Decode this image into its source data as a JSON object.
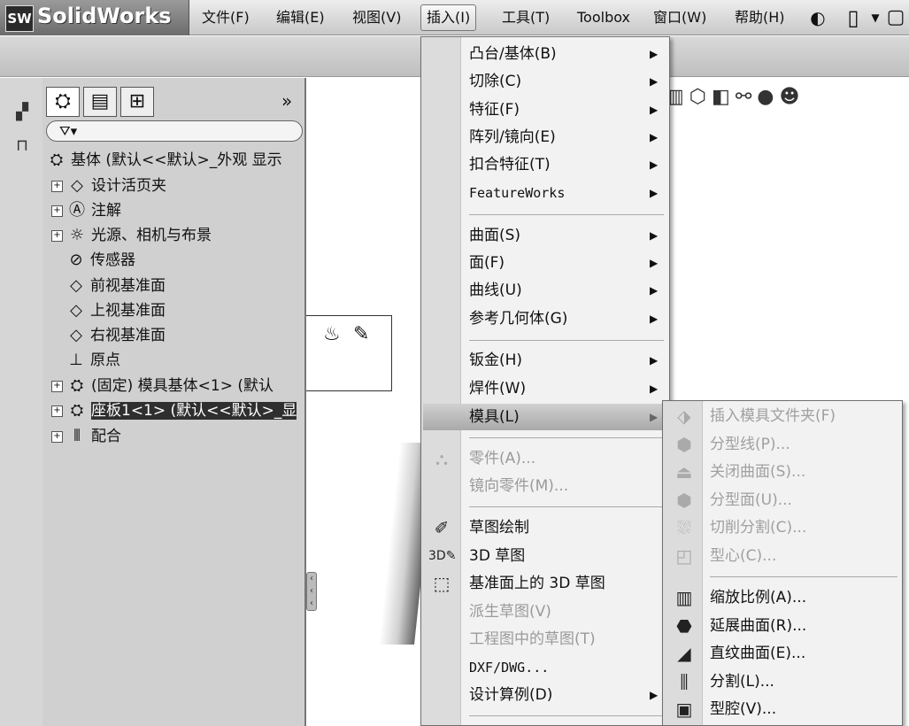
{
  "app": {
    "logo_badge": "SW",
    "logo_text": "SolidWorks"
  },
  "menubar": {
    "items": [
      {
        "label": "文件(F)"
      },
      {
        "label": "编辑(E)"
      },
      {
        "label": "视图(V)"
      },
      {
        "label": "插入(I)"
      },
      {
        "label": "工具(T)"
      },
      {
        "label": "Toolbox"
      },
      {
        "label": "窗口(W)"
      },
      {
        "label": "帮助(H)"
      }
    ],
    "active_index": 3
  },
  "tree": {
    "collapse_label": "»",
    "filter_label": "▾",
    "root": "基体  (默认<<默认>_外观 显示",
    "nodes": [
      {
        "label": "设计活页夹",
        "expand": "+",
        "icon": "binder-icon"
      },
      {
        "label": "注解",
        "expand": "+",
        "icon": "annotation-icon"
      },
      {
        "label": "光源、相机与布景",
        "expand": "+",
        "icon": "lights-icon"
      },
      {
        "label": "传感器",
        "expand": "",
        "icon": "sensor-icon"
      },
      {
        "label": "前视基准面",
        "expand": "",
        "icon": "plane-icon"
      },
      {
        "label": "上视基准面",
        "expand": "",
        "icon": "plane-icon"
      },
      {
        "label": "右视基准面",
        "expand": "",
        "icon": "plane-icon"
      },
      {
        "label": "原点",
        "expand": "",
        "icon": "origin-icon"
      },
      {
        "label": "(固定) 模具基体<1> (默认",
        "expand": "+",
        "icon": "part-icon"
      },
      {
        "label": "座板1<1> (默认<<默认>_显",
        "expand": "+",
        "icon": "part-icon",
        "selected": true
      },
      {
        "label": "配合",
        "expand": "+",
        "icon": "mates-icon"
      }
    ]
  },
  "insert_menu": {
    "items": [
      {
        "label": "凸台/基体(B)",
        "submenu": true
      },
      {
        "label": "切除(C)",
        "submenu": true
      },
      {
        "label": "特征(F)",
        "submenu": true
      },
      {
        "label": "阵列/镜向(E)",
        "submenu": true
      },
      {
        "label": "扣合特征(T)",
        "submenu": true
      },
      {
        "label": "FeatureWorks",
        "submenu": true
      },
      {
        "label": "曲面(S)",
        "submenu": true
      },
      {
        "label": "面(F)",
        "submenu": true
      },
      {
        "label": "曲线(U)",
        "submenu": true
      },
      {
        "label": "参考几何体(G)",
        "submenu": true
      },
      {
        "label": "钣金(H)",
        "submenu": true
      },
      {
        "label": "焊件(W)",
        "submenu": true
      },
      {
        "label": "模具(L)",
        "submenu": true,
        "highlighted": true
      },
      {
        "label": "零件(A)...",
        "disabled": true
      },
      {
        "label": "镜向零件(M)...",
        "disabled": true
      },
      {
        "label": "草图绘制"
      },
      {
        "label": "3D 草图"
      },
      {
        "label": "基准面上的 3D 草图"
      },
      {
        "label": "派生草图(V)",
        "disabled": true
      },
      {
        "label": "工程图中的草图(T)",
        "disabled": true
      },
      {
        "label": "DXF/DWG..."
      },
      {
        "label": "设计算例(D)",
        "submenu": true
      }
    ],
    "arrow": "▶"
  },
  "mold_submenu": {
    "items": [
      {
        "label": "插入模具文件夹(F)",
        "disabled": true
      },
      {
        "label": "分型线(P)...",
        "disabled": true
      },
      {
        "label": "关闭曲面(S)...",
        "disabled": true
      },
      {
        "label": "分型面(U)...",
        "disabled": true
      },
      {
        "label": "切削分割(C)...",
        "disabled": true
      },
      {
        "label": "型心(C)...",
        "disabled": true
      },
      {
        "label": "缩放比例(A)..."
      },
      {
        "label": "延展曲面(R)..."
      },
      {
        "label": "直纹曲面(E)..."
      },
      {
        "label": "分割(L)..."
      },
      {
        "label": "型腔(V)..."
      }
    ]
  }
}
